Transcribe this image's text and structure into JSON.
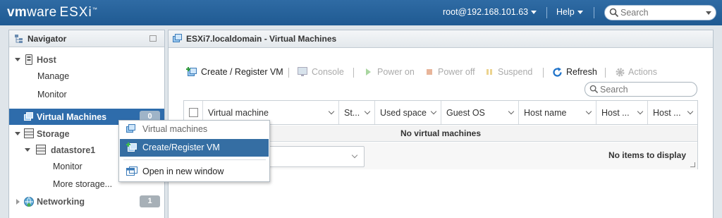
{
  "app": {
    "brand_vm": "vm",
    "brand_ware": "ware",
    "brand_product": "ESXi"
  },
  "topbar": {
    "user": "root@192.168.101.63",
    "help": "Help",
    "search_placeholder": "Search"
  },
  "navigator": {
    "title": "Navigator",
    "items": [
      {
        "label": "Host",
        "icon": "host-icon"
      },
      {
        "label": "Manage"
      },
      {
        "label": "Monitor"
      },
      {
        "label": "Virtual Machines",
        "icon": "vm-icon",
        "badge": "0",
        "selected": true
      },
      {
        "label": "Storage",
        "icon": "storage-icon"
      },
      {
        "label": "datastore1",
        "icon": "datastore-icon"
      },
      {
        "label": "Monitor"
      },
      {
        "label": "More storage..."
      },
      {
        "label": "Networking",
        "icon": "network-icon",
        "badge": "1"
      }
    ]
  },
  "main": {
    "title": "ESXi7.localdomain - Virtual Machines",
    "toolbar": {
      "create": "Create / Register VM",
      "console": "Console",
      "power_on": "Power on",
      "power_off": "Power off",
      "suspend": "Suspend",
      "refresh": "Refresh",
      "actions": "Actions"
    },
    "search_placeholder": "Search",
    "columns": [
      "Virtual machine",
      "St...",
      "Used space",
      "Guest OS",
      "Host name",
      "Host ...",
      "Host ..."
    ],
    "empty_message": "No virtual machines",
    "footer_status": "No items to display"
  },
  "context_menu": {
    "header": "Virtual machines",
    "items": [
      "Create/Register VM",
      "Open in new window"
    ]
  },
  "colors": {
    "topbar": "#2564a0",
    "selection": "#2e6cab",
    "refresh_accent": "#1f73c9"
  }
}
